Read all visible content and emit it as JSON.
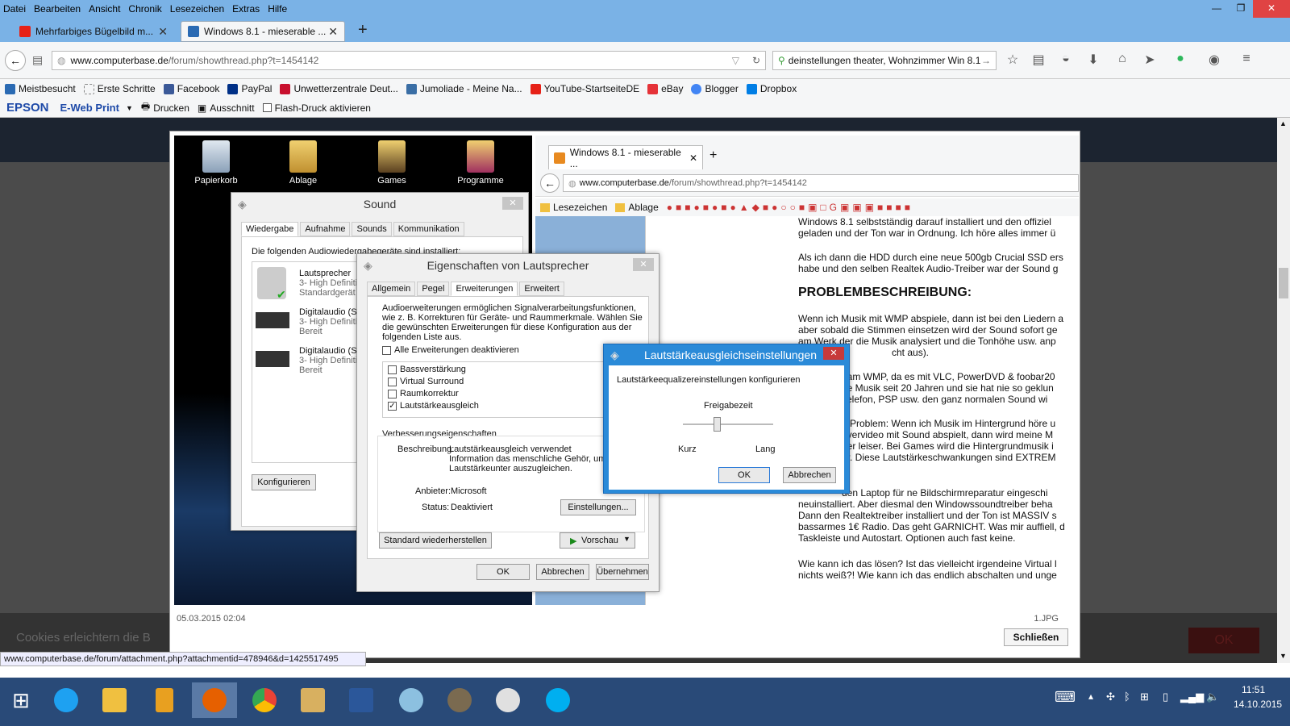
{
  "menubar": {
    "items": [
      "Datei",
      "Bearbeiten",
      "Ansicht",
      "Chronik",
      "Lesezeichen",
      "Extras",
      "Hilfe"
    ],
    "min": "—",
    "max": "❐",
    "close": "✕"
  },
  "tabs": [
    {
      "title": "Mehrfarbiges Bügelbild m...",
      "icon_color": "#e62117"
    },
    {
      "title": "Windows 8.1 - mieserable ...",
      "icon_color": "#2a6ab3"
    }
  ],
  "newtab": "+",
  "nav": {
    "url_host": "www.computerbase.de",
    "url_path": "/forum/showthread.php?t=1454142",
    "search_value": "deinstellungen theater, Wohnzimmer Win 8.1"
  },
  "bookmarks": [
    {
      "label": "Meistbesucht",
      "color": "#2a6ab3"
    },
    {
      "label": "Erste Schritte",
      "color": "#ffffff"
    },
    {
      "label": "Facebook",
      "color": "#3b5998"
    },
    {
      "label": "PayPal",
      "color": "#003087"
    },
    {
      "label": "Unwetterzentrale Deut...",
      "color": "#c8102e"
    },
    {
      "label": "Jumoliade - Meine Na...",
      "color": "#3a6ea5"
    },
    {
      "label": "YouTube-StartseiteDE",
      "color": "#e62117"
    },
    {
      "label": "eBay",
      "color": "#e53238"
    },
    {
      "label": "Blogger",
      "color": "#4285f4"
    },
    {
      "label": "Dropbox",
      "color": "#007ee5"
    }
  ],
  "epson": {
    "brand": "EPSON",
    "product": "E-Web Print",
    "print": "Drucken",
    "clip": "Ausschnitt",
    "flash": "Flash-Druck aktivieren"
  },
  "lightbox": {
    "date": "05.03.2015 02:04",
    "filename": "1.JPG",
    "close_label": "Schließen"
  },
  "cookie": {
    "text": "Cookies erleichtern die B",
    "ok": "OK"
  },
  "status_url": "www.computerbase.de/forum/attachment.php?attachmentid=478946&d=1425517495",
  "desktop": {
    "icons": [
      "Papierkorb",
      "Ablage",
      "Games",
      "Programme"
    ]
  },
  "sound_dialog": {
    "title": "Sound",
    "tabs": [
      "Wiedergabe",
      "Aufnahme",
      "Sounds",
      "Kommunikation"
    ],
    "intro": "Die folgenden Audiowiedergabegeräte sind installiert:",
    "devices": [
      {
        "name": "Lautsprecher",
        "line1": "3- High Definiti",
        "line2": "Standardgerät"
      },
      {
        "name": "Digitalaudio (S/",
        "line1": "3- High Definiti",
        "line2": "Bereit"
      },
      {
        "name": "Digitalaudio (S/",
        "line1": "3- High Definiti",
        "line2": "Bereit"
      }
    ],
    "configure": "Konfigurieren"
  },
  "props_dialog": {
    "title": "Eigenschaften von Lautsprecher",
    "tabs": [
      "Allgemein",
      "Pegel",
      "Erweiterungen",
      "Erweitert"
    ],
    "intro": "Audioerweiterungen ermöglichen Signalverarbeitungsfunktionen, wie z. B. Korrekturen für Geräte- und Raummerkmale. Wählen Sie die gewünschten Erweiterungen für diese Konfiguration aus der folgenden Liste aus.",
    "disable_all": "Alle Erweiterungen deaktivieren",
    "options": [
      {
        "label": "Bassverstärkung",
        "checked": ""
      },
      {
        "label": "Virtual Surround",
        "checked": ""
      },
      {
        "label": "Raumkorrektur",
        "checked": ""
      },
      {
        "label": "Lautstärkeausgleich",
        "checked": "✓"
      }
    ],
    "group": "Verbesserungseigenschaften",
    "desc_label": "Beschreibung:",
    "desc_text": "Lautstärkeausgleich verwendet Information das menschliche Gehör, um Lautstärkeunter auszugleichen.",
    "vendor_label": "Anbieter:",
    "vendor": "Microsoft",
    "status_label": "Status:",
    "status": "Deaktiviert",
    "settings": "Einstellungen...",
    "restore": "Standard wiederherstellen",
    "preview": "Vorschau",
    "ok": "OK",
    "cancel": "Abbrechen",
    "apply": "Übernehmen"
  },
  "eq_dialog": {
    "title": "Lautstärkeausgleichseinstellungen",
    "subtitle": "Lautstärkeequalizereinstellungen konfigurieren",
    "slider_label": "Freigabezeit",
    "min": "Kurz",
    "max": "Lang",
    "ok": "OK",
    "cancel": "Abbrechen"
  },
  "inner_browser": {
    "tab": "Windows 8.1 - mieserable ...",
    "url_host": "www.computerbase.de",
    "url_path": "/forum/showthread.php?t=1454142",
    "bookmarks": [
      "Lesezeichen",
      "Ablage"
    ],
    "article": {
      "p1": [
        "Windows 8.1 selbstständig darauf installiert und den offiziel",
        "geladen und der Ton war in Ordnung. Ich höre alles immer ü"
      ],
      "p2": [
        "Als ich dann die HDD durch eine neue 500gb Crucial SSD ers",
        "habe und den selben Realtek Audio-Treiber war der Sound g"
      ],
      "heading": "PROBLEMBESCHREIBUNG:",
      "p3": [
        "Wenn ich Musik mit WMP abspiele, dann ist bei den Liedern a",
        "aber sobald die Stimmen einsetzen wird der Sound sofort ge",
        "am Werk der die Musik analysiert und die Tonhöhe usw. anp",
        "cht aus)."
      ],
      "p4": [
        "t am WMP, da es mit VLC, PowerDVD & foobar20",
        "ie Musik seit 20 Jahren und sie hat nie so geklun",
        "Telefon, PSP usw. den ganz normalen Sound wi"
      ],
      "p5": [
        "e Problem: Wenn ich Musik im Hintergrund höre u",
        "ayervideo mit Sound abspielt, dann wird meine M",
        "der leiser. Bei Games wird die Hintergrundmusik i",
        "er. Diese Lautstärkeschwankungen sind EXTREM"
      ],
      "p6": [
        "den Laptop für ne Bildschirmreparatur eingeschi",
        "neuinstalliert. Aber diesmal den Windowssoundtreiber beha",
        "Dann den Realtektreiber installiert und der Ton ist MASSIV s",
        "bassarmes 1€ Radio. Das geht GARNICHT. Was mir auffiell, d",
        "Taskleiste und Autostart. Optionen auch fast keine."
      ],
      "p7": [
        "Wie kann ich das lösen? Ist das vielleicht irgendeine Virtual l",
        "nichts weiß?! Wie kann ich das endlich abschalten und unge"
      ]
    }
  },
  "taskbar": {
    "apps": [
      {
        "name": "windows-start",
        "color": "#ffffff"
      },
      {
        "name": "internet-explorer",
        "color": "#1ea1f1"
      },
      {
        "name": "file-explorer",
        "color": "#f0c040"
      },
      {
        "name": "notes-app",
        "color": "#e8a020"
      },
      {
        "name": "firefox",
        "color": "#e66000"
      },
      {
        "name": "chrome",
        "color": "#34a853"
      },
      {
        "name": "folder-app",
        "color": "#d8b060"
      },
      {
        "name": "word",
        "color": "#2b579a"
      },
      {
        "name": "paint",
        "color": "#8cc0e0"
      },
      {
        "name": "gimp",
        "color": "#7a6a50"
      },
      {
        "name": "snipping-tool",
        "color": "#e0e0e0"
      },
      {
        "name": "skype",
        "color": "#00aff0"
      }
    ],
    "time": "11:51",
    "date": "14.10.2015"
  }
}
